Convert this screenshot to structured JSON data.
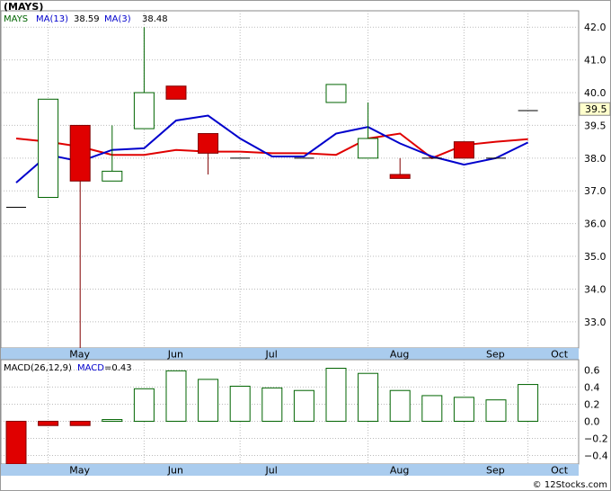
{
  "ticker": "(MAYS)",
  "watermark": "© 12Stocks.com",
  "colors": {
    "up": "#006400",
    "down": "#e00000",
    "ma13": "#e00000",
    "ma3": "#0000cc",
    "axis_bg": "#aaccee",
    "grid": "#bbbbbb"
  },
  "chart_data": [
    {
      "type": "candlestick",
      "legend": [
        {
          "name": "MAYS",
          "value": "",
          "color": "#006400"
        },
        {
          "name": "MA(13)",
          "value": "38.59",
          "color": "#0000cc"
        },
        {
          "name": "MA(3)",
          "value": "38.48",
          "color": "#0000cc"
        }
      ],
      "ylim": [
        32.2,
        42.5
      ],
      "y_ticks": [
        "42.0",
        "41.0",
        "40.0",
        "39.5",
        "38.0",
        "37.0",
        "36.0",
        "35.0",
        "34.0",
        "33.0"
      ],
      "y_tick_values": [
        42,
        41,
        40,
        39,
        38,
        37,
        36,
        35,
        34,
        33
      ],
      "last_price_label": "39.5",
      "last_price": 39.5,
      "x_ticks": [
        {
          "label": "May",
          "t": 1.0
        },
        {
          "label": "Jun",
          "t": 4.0
        },
        {
          "label": "Jul",
          "t": 7.0
        },
        {
          "label": "Aug",
          "t": 11.0
        },
        {
          "label": "Sep",
          "t": 14.0
        },
        {
          "label": "Oct",
          "t": 16.0
        }
      ],
      "candles": [
        {
          "t": 0,
          "open": 36.5,
          "close": 36.5,
          "high": 36.5,
          "low": 36.5
        },
        {
          "t": 1,
          "open": 36.8,
          "close": 39.8,
          "high": 39.8,
          "low": 36.8
        },
        {
          "t": 2,
          "open": 39.0,
          "close": 37.3,
          "high": 39.0,
          "low": 32.2
        },
        {
          "t": 3,
          "open": 37.3,
          "close": 37.6,
          "high": 39.0,
          "low": 37.3
        },
        {
          "t": 4,
          "open": 38.9,
          "close": 40.0,
          "high": 42.0,
          "low": 38.9
        },
        {
          "t": 5,
          "open": 40.2,
          "close": 39.8,
          "high": 40.2,
          "low": 39.8
        },
        {
          "t": 6,
          "open": 38.75,
          "close": 38.15,
          "high": 38.75,
          "low": 37.5
        },
        {
          "t": 7,
          "open": 38.0,
          "close": 38.0,
          "high": 38.0,
          "low": 38.0
        },
        {
          "t": 9,
          "open": 38.0,
          "close": 38.0,
          "high": 38.0,
          "low": 38.0
        },
        {
          "t": 10,
          "open": 39.7,
          "close": 40.25,
          "high": 40.25,
          "low": 39.7
        },
        {
          "t": 11,
          "open": 38.0,
          "close": 38.6,
          "high": 39.7,
          "low": 38.0
        },
        {
          "t": 12,
          "open": 37.5,
          "close": 37.38,
          "high": 38.0,
          "low": 37.38
        },
        {
          "t": 13,
          "open": 38.0,
          "close": 38.0,
          "high": 38.0,
          "low": 38.0
        },
        {
          "t": 14,
          "open": 38.5,
          "close": 38.0,
          "high": 38.5,
          "low": 38.0
        },
        {
          "t": 15,
          "open": 38.0,
          "close": 38.0,
          "high": 38.0,
          "low": 38.0
        },
        {
          "t": 16,
          "open": 39.45,
          "close": 39.45,
          "high": 39.45,
          "low": 39.45
        }
      ],
      "series": [
        {
          "name": "MA(13)",
          "color": "#e00000",
          "points": [
            [
              0,
              38.6
            ],
            [
              1,
              38.5
            ],
            [
              2,
              38.35
            ],
            [
              3,
              38.1
            ],
            [
              4,
              38.1
            ],
            [
              5,
              38.25
            ],
            [
              6,
              38.2
            ],
            [
              7,
              38.2
            ],
            [
              8,
              38.15
            ],
            [
              9,
              38.15
            ],
            [
              10,
              38.1
            ],
            [
              11,
              38.6
            ],
            [
              12,
              38.75
            ],
            [
              13,
              38.0
            ],
            [
              14,
              38.4
            ],
            [
              15,
              38.5
            ],
            [
              16,
              38.58
            ]
          ]
        },
        {
          "name": "MA(3)",
          "color": "#0000cc",
          "points": [
            [
              0,
              37.25
            ],
            [
              1,
              38.1
            ],
            [
              2,
              37.9
            ],
            [
              3,
              38.25
            ],
            [
              4,
              38.3
            ],
            [
              5,
              39.15
            ],
            [
              6,
              39.3
            ],
            [
              7,
              38.6
            ],
            [
              8,
              38.05
            ],
            [
              9,
              38.05
            ],
            [
              10,
              38.75
            ],
            [
              11,
              38.95
            ],
            [
              12,
              38.45
            ],
            [
              13,
              38.05
            ],
            [
              14,
              37.8
            ],
            [
              15,
              38.0
            ],
            [
              16,
              38.48
            ]
          ]
        }
      ]
    },
    {
      "type": "bar",
      "legend": [
        {
          "name": "MACD(26,12,9)",
          "value": "",
          "color": "#000000"
        },
        {
          "name": "MACD",
          "value": "0.43",
          "color": "#0000cc"
        }
      ],
      "ylim": [
        -0.5,
        0.72
      ],
      "y_ticks": [
        "0.6",
        "0.4",
        "0.2",
        "0.0",
        "−0.2",
        "−0.4"
      ],
      "y_tick_values": [
        0.6,
        0.4,
        0.2,
        0.0,
        -0.2,
        -0.4
      ],
      "x_ticks": [
        {
          "label": "May",
          "t": 1.0
        },
        {
          "label": "Jun",
          "t": 4.0
        },
        {
          "label": "Jul",
          "t": 7.0
        },
        {
          "label": "Aug",
          "t": 11.0
        },
        {
          "label": "Sep",
          "t": 14.0
        },
        {
          "label": "Oct",
          "t": 16.0
        }
      ],
      "bars": [
        {
          "t": 0,
          "value": -0.5
        },
        {
          "t": 1,
          "value": -0.05
        },
        {
          "t": 2,
          "value": -0.05
        },
        {
          "t": 3,
          "value": 0.02
        },
        {
          "t": 4,
          "value": 0.38
        },
        {
          "t": 5,
          "value": 0.59
        },
        {
          "t": 6,
          "value": 0.49
        },
        {
          "t": 7,
          "value": 0.41
        },
        {
          "t": 8,
          "value": 0.39
        },
        {
          "t": 9,
          "value": 0.36
        },
        {
          "t": 10,
          "value": 0.62
        },
        {
          "t": 11,
          "value": 0.56
        },
        {
          "t": 12,
          "value": 0.36
        },
        {
          "t": 13,
          "value": 0.3
        },
        {
          "t": 14,
          "value": 0.28
        },
        {
          "t": 15,
          "value": 0.25
        },
        {
          "t": 16,
          "value": 0.43
        }
      ]
    }
  ]
}
